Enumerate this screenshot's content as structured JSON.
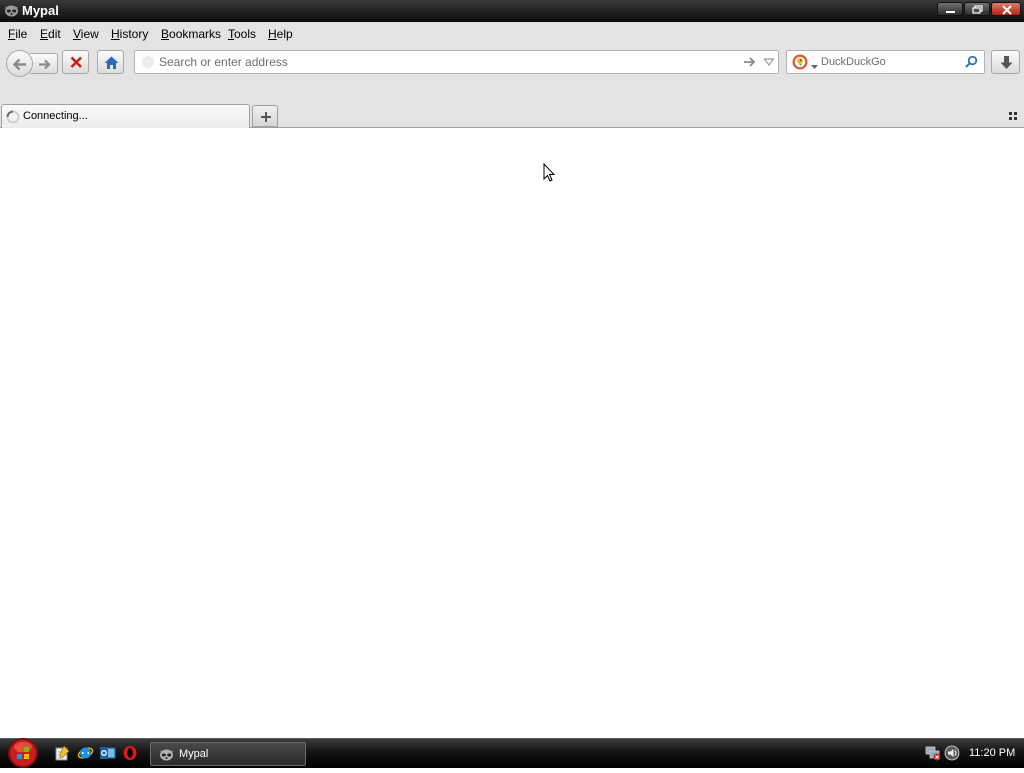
{
  "window": {
    "title": "Mypal",
    "icon": "mypal-raccoon-icon"
  },
  "menubar": {
    "items": [
      {
        "label": "File",
        "accesskey": "F"
      },
      {
        "label": "Edit",
        "accesskey": "E"
      },
      {
        "label": "View",
        "accesskey": "V"
      },
      {
        "label": "History",
        "accesskey": "H"
      },
      {
        "label": "Bookmarks",
        "accesskey": "B"
      },
      {
        "label": "Tools",
        "accesskey": "T"
      },
      {
        "label": "Help",
        "accesskey": "H"
      }
    ]
  },
  "navbar": {
    "back_icon": "back-arrow-icon",
    "forward_icon": "forward-arrow-icon",
    "stop_icon": "stop-x-icon",
    "home_icon": "home-icon",
    "url": {
      "value": "",
      "placeholder": "Search or enter address"
    },
    "search": {
      "engine_icon": "duckduckgo-icon",
      "value": "",
      "placeholder": "DuckDuckGo"
    },
    "download_icon": "download-arrow-icon"
  },
  "tabs": [
    {
      "title": "Connecting...",
      "state": "loading",
      "icon": "loading-spinner-icon"
    }
  ],
  "taskbar": {
    "quick_launch": [
      "notepad-icon",
      "internet-explorer-icon",
      "outlook-icon",
      "opera-icon"
    ],
    "tasks": [
      {
        "label": "Mypal",
        "icon": "mypal-raccoon-icon"
      }
    ],
    "clock": "11:20 PM"
  },
  "colors": {
    "chrome_bg": "#e3e3e3",
    "close_button": "#c4301d",
    "home_icon": "#2b6cb8",
    "stop_icon": "#c22020",
    "taskbar": "#141414"
  }
}
